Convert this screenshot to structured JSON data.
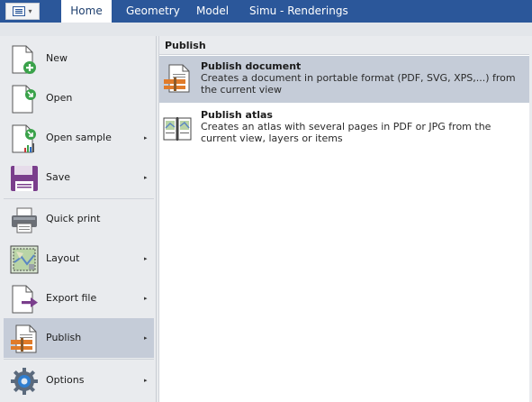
{
  "ribbon": {
    "tabs": [
      {
        "label": "Home",
        "active": true
      },
      {
        "label": "Geometry",
        "active": false
      },
      {
        "label": "Model",
        "active": false
      },
      {
        "label": "Simu - Renderings",
        "active": false
      }
    ]
  },
  "menu": {
    "items": [
      {
        "label": "New",
        "icon": "new-document-icon",
        "has_submenu": false
      },
      {
        "label": "Open",
        "icon": "open-document-icon",
        "has_submenu": false
      },
      {
        "label": "Open sample",
        "icon": "open-sample-icon",
        "has_submenu": true
      },
      {
        "label": "Save",
        "icon": "floppy-disk-icon",
        "has_submenu": true
      },
      {
        "label": "Quick print",
        "icon": "printer-icon",
        "has_submenu": false
      },
      {
        "label": "Layout",
        "icon": "map-layout-icon",
        "has_submenu": true
      },
      {
        "label": "Export file",
        "icon": "export-icon",
        "has_submenu": true
      },
      {
        "label": "Publish",
        "icon": "publish-icon",
        "has_submenu": true,
        "selected": true
      },
      {
        "label": "Options",
        "icon": "gear-icon",
        "has_submenu": true
      }
    ]
  },
  "panel": {
    "header": "Publish",
    "entries": [
      {
        "title": "Publish document",
        "description": "Creates a document in portable format (PDF, SVG, XPS,...) from the current view",
        "icon": "publish-document-icon",
        "highlighted": true
      },
      {
        "title": "Publish atlas",
        "description": "Creates an atlas with several pages in PDF or JPG from the current view, layers or items",
        "icon": "atlas-book-icon",
        "highlighted": false
      }
    ]
  },
  "colors": {
    "ribbon": "#2b579a",
    "selection": "#c5ccd8",
    "accent_green": "#3aa24a",
    "accent_purple": "#7a3e8c",
    "accent_orange": "#e07b2a"
  },
  "glyphs": {
    "submenu_arrow": "▸",
    "app_chevron": "▾"
  }
}
